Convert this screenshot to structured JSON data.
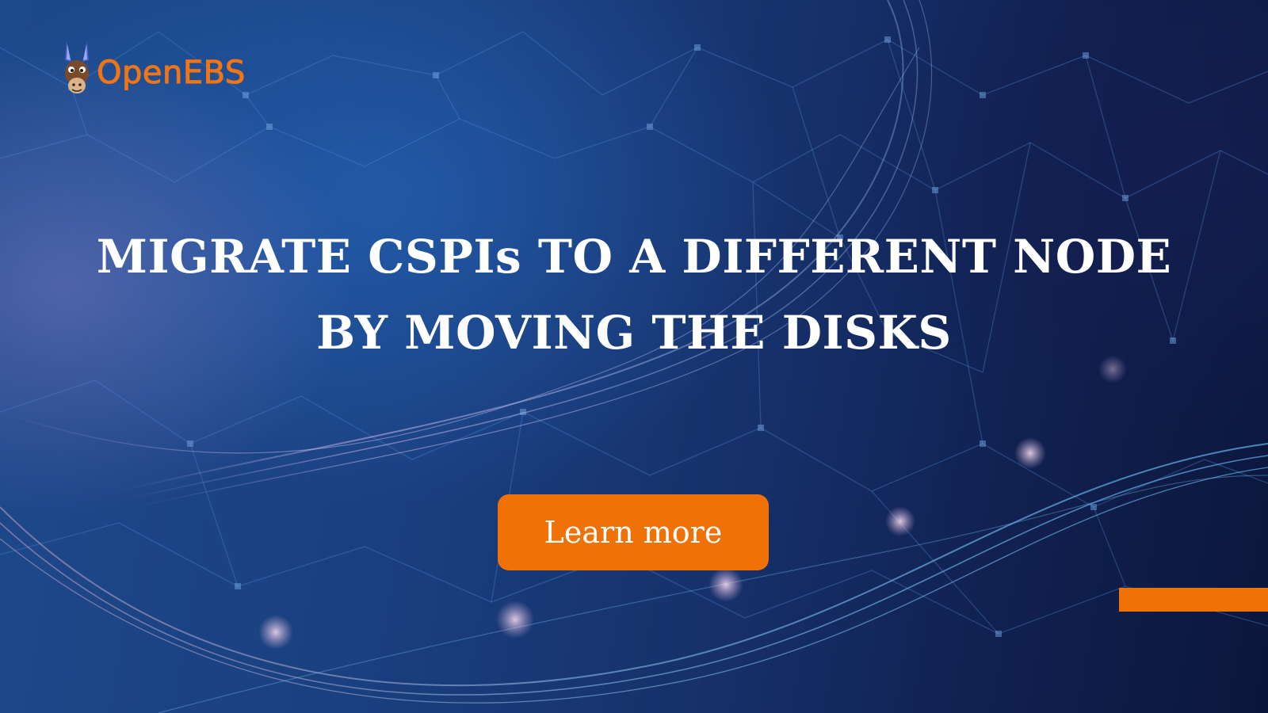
{
  "brand": {
    "logo_text": "OpenEBS",
    "logo_icon": "donkey-mascot-icon",
    "color": "#f07514"
  },
  "hero": {
    "headline_line1": "MIGRATE CSPIs TO A DIFFERENT NODE",
    "headline_line2": "BY MOVING THE DISKS"
  },
  "cta": {
    "label": "Learn more",
    "color": "#f07207"
  },
  "colors": {
    "background_dark": "#0b163b",
    "background_blue": "#1d4a8c",
    "accent": "#f07207",
    "text": "#ffffff"
  }
}
